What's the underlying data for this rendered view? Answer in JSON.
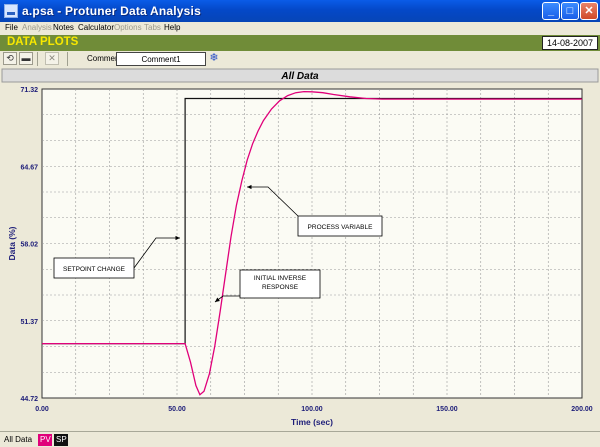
{
  "window": {
    "title": "a.psa - Protuner Data  Analysis",
    "min": "_",
    "max": "□",
    "close": "✕"
  },
  "menu": [
    {
      "label": "File",
      "enabled": true
    },
    {
      "label": "Analysis",
      "enabled": false
    },
    {
      "label": "Notes",
      "enabled": true
    },
    {
      "label": "Calculator",
      "enabled": true
    },
    {
      "label": "Options",
      "enabled": false
    },
    {
      "label": "Tabs",
      "enabled": false
    },
    {
      "label": "Help",
      "enabled": true
    }
  ],
  "header": {
    "title": "DATA PLOTS",
    "date": "14-08-2007"
  },
  "toolbar": {
    "comment_label": "Comment",
    "comment_value": "Comment1"
  },
  "tabs": [
    "All Data",
    "PV",
    "SP"
  ],
  "colors": {
    "pv": "#e0007a",
    "sp": "#111111",
    "header_bg": "#708c38",
    "header_text": "#f8e800",
    "axis_label": "#1c1c78"
  },
  "chart_data": {
    "type": "line",
    "title": "All Data",
    "xlabel": "Time (sec)",
    "ylabel": "Data (%)",
    "xlim": [
      0,
      200
    ],
    "ylim": [
      44.72,
      71.32
    ],
    "xticks": [
      "0.00",
      "50.00",
      "100.00",
      "150.00",
      "200.00"
    ],
    "yticks": [
      "44.72",
      "51.37",
      "58.02",
      "64.67",
      "71.32"
    ],
    "grid": true,
    "series": [
      {
        "name": "SP",
        "x": [
          0,
          53,
          53,
          200
        ],
        "y": [
          49.4,
          49.4,
          70.5,
          70.5
        ]
      },
      {
        "name": "PV",
        "x": [
          0,
          53,
          55,
          57,
          58.5,
          60,
          62,
          64,
          66,
          68,
          70,
          72,
          74,
          76,
          78,
          80,
          82,
          85,
          88,
          91,
          94,
          97,
          100,
          104,
          108,
          114,
          120,
          126,
          132,
          140,
          150,
          160,
          170,
          180,
          200
        ],
        "y": [
          49.4,
          49.4,
          47.8,
          45.8,
          45.0,
          45.3,
          46.8,
          49.2,
          52.2,
          55.4,
          58.6,
          61.3,
          63.4,
          65.2,
          66.6,
          67.7,
          68.6,
          69.6,
          70.3,
          70.75,
          71.0,
          71.1,
          71.08,
          71.0,
          70.85,
          70.65,
          70.5,
          70.45,
          70.45,
          70.45,
          70.45,
          70.45,
          70.45,
          70.45,
          70.45
        ]
      }
    ],
    "annotations": [
      {
        "text": [
          "SETPOINT CHANGE"
        ],
        "at": [
          53,
          58.4
        ]
      },
      {
        "text": [
          "PROCESS VARIABLE"
        ],
        "at": [
          77,
          63.8
        ]
      },
      {
        "text": [
          "INITIAL INVERSE",
          "RESPONSE"
        ],
        "at": [
          63,
          47.1
        ]
      }
    ]
  }
}
